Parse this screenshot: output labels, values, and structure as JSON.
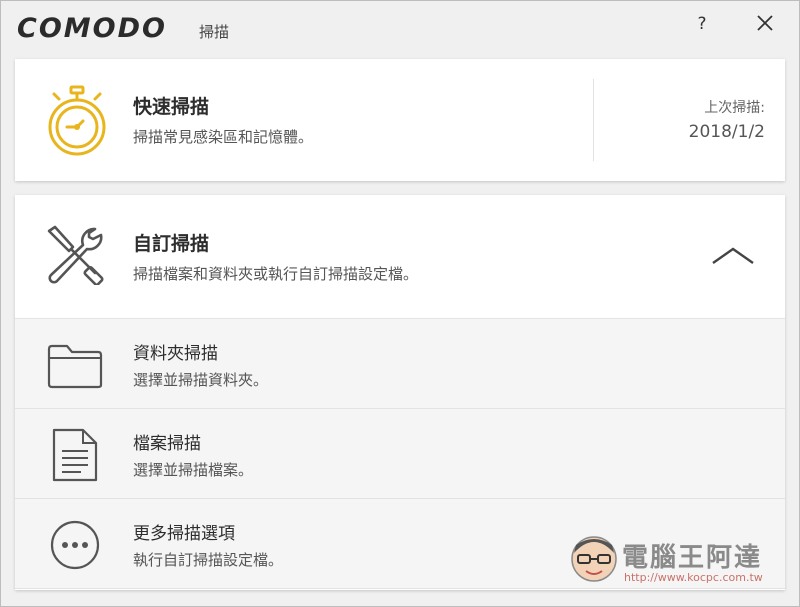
{
  "app": {
    "brand": "COMODO",
    "window_title": "掃描",
    "help_label": "?"
  },
  "quick_scan": {
    "title": "快速掃描",
    "description": "掃描常見感染區和記憶體。",
    "last_scan_label": "上次掃描:",
    "last_scan_date": "2018/1/2",
    "icon": "stopwatch-icon",
    "accent_color": "#e8b51c"
  },
  "custom_scan": {
    "title": "自訂掃描",
    "description": "掃描檔案和資料夾或執行自訂掃描設定檔。",
    "icon": "tools-icon",
    "expanded": true,
    "items": [
      {
        "title": "資料夾掃描",
        "description": "選擇並掃描資料夾。",
        "icon": "folder-icon"
      },
      {
        "title": "檔案掃描",
        "description": "選擇並掃描檔案。",
        "icon": "file-icon"
      },
      {
        "title": "更多掃描選項",
        "description": "執行自訂掃描設定檔。",
        "icon": "more-icon"
      }
    ]
  },
  "watermark": {
    "title": "電腦王阿達",
    "url": "http://www.kocpc.com.tw"
  }
}
